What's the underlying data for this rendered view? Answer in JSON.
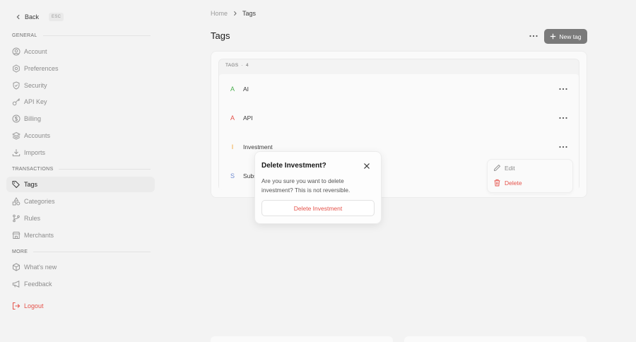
{
  "nav": {
    "back_label": "Back",
    "esc_label": "ESC",
    "sections": {
      "general": "GENERAL",
      "transactions": "TRANSACTIONS",
      "more": "MORE"
    },
    "items": [
      {
        "label": "Account",
        "icon": "user-circle-icon"
      },
      {
        "label": "Preferences",
        "icon": "settings-icon"
      },
      {
        "label": "Security",
        "icon": "shield-icon"
      },
      {
        "label": "API Key",
        "icon": "key-icon"
      },
      {
        "label": "Billing",
        "icon": "dollar-icon"
      },
      {
        "label": "Accounts",
        "icon": "layers-icon"
      },
      {
        "label": "Imports",
        "icon": "download-icon"
      },
      {
        "label": "Tags",
        "icon": "tags-icon"
      },
      {
        "label": "Categories",
        "icon": "shapes-icon"
      },
      {
        "label": "Rules",
        "icon": "git-branch-icon"
      },
      {
        "label": "Merchants",
        "icon": "store-icon"
      },
      {
        "label": "What's new",
        "icon": "box-icon"
      },
      {
        "label": "Feedback",
        "icon": "megaphone-icon"
      }
    ],
    "logout_label": "Logout"
  },
  "breadcrumb": {
    "home": "Home",
    "current": "Tags"
  },
  "page": {
    "title": "Tags",
    "new_tag_label": "New tag"
  },
  "tags_header": {
    "label": "TAGS",
    "separator": "·",
    "count": "4"
  },
  "tags": [
    {
      "initial": "A",
      "name": "AI",
      "color": "#4caf50"
    },
    {
      "initial": "A",
      "name": "API",
      "color": "#e5534b"
    },
    {
      "initial": "I",
      "name": "Investment",
      "color": "#f0a030"
    },
    {
      "initial": "S",
      "name": "Subs",
      "color": "#6e8ad0"
    }
  ],
  "menu": {
    "edit_label": "Edit",
    "delete_label": "Delete"
  },
  "modal": {
    "title": "Delete Investment?",
    "body": "Are you sure you want to delete investment? This is not reversible.",
    "confirm_label": "Delete Investment"
  },
  "colors": {
    "danger": "#e5534b",
    "primary_button": "#7a7a7a",
    "background": "#f3f3f3"
  }
}
